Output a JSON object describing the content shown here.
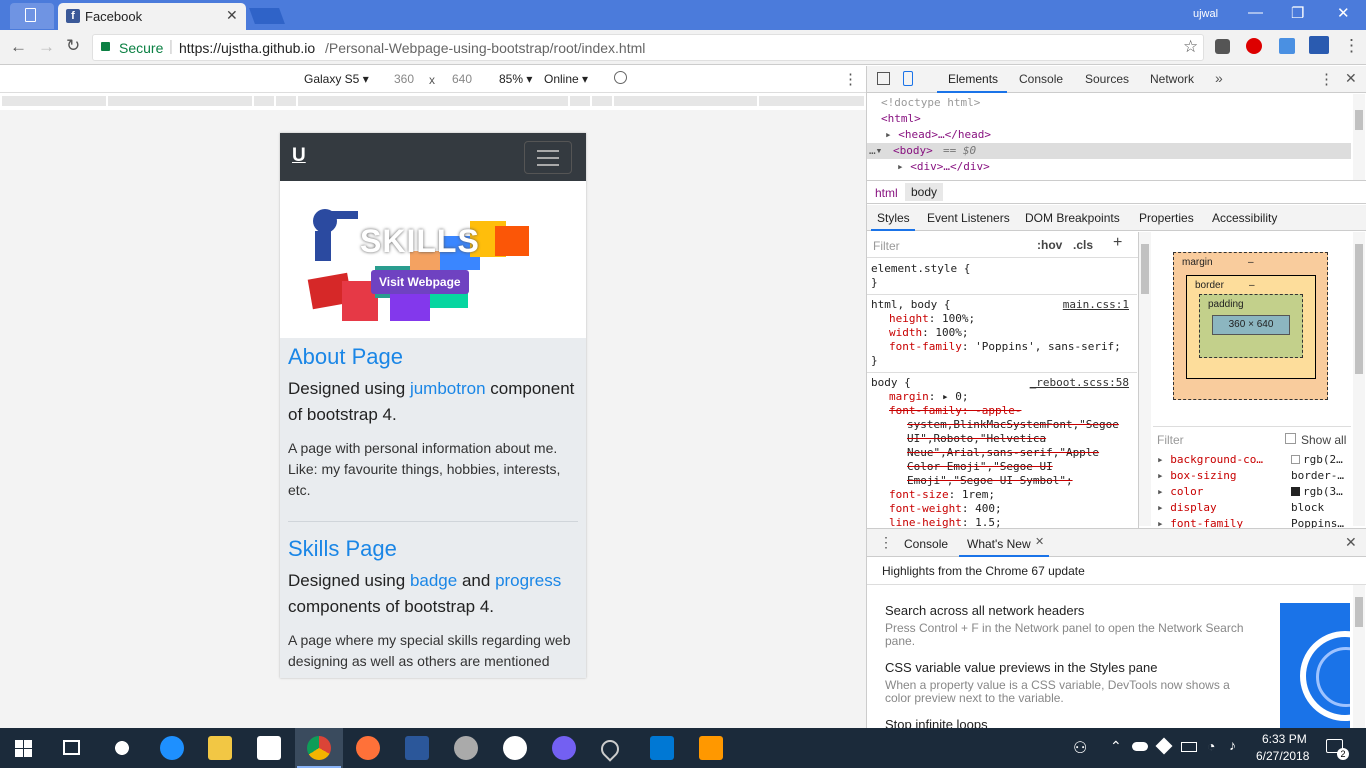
{
  "window": {
    "tab_title": "Facebook",
    "user": "ujwal"
  },
  "address": {
    "secure_label": "Secure",
    "url_host": "https://ujstha.github.io",
    "url_path": "/Personal-Webpage-using-bootstrap/root/index.html"
  },
  "device_toolbar": {
    "device": "Galaxy S5",
    "width": "360",
    "times": "x",
    "height": "640",
    "zoom": "85%",
    "network": "Online"
  },
  "page": {
    "brand": "U",
    "hero_text": "SKILLS",
    "hero_button": "Visit Webpage",
    "about": {
      "title": "About Page",
      "lead_prefix": "Designed using",
      "lead_link": "jumbotron",
      "lead_suffix": "component of bootstrap 4.",
      "para": "A page with personal information about me. Like: my favourite things, hobbies, interests, etc."
    },
    "skills": {
      "title": "Skills Page",
      "lead_prefix": "Designed using",
      "lead_link1": "badge",
      "lead_and": "and",
      "lead_link2": "progress",
      "lead_suffix": "components of bootstrap 4.",
      "para": "A page where my special skills regarding web designing as well as others are mentioned"
    }
  },
  "devtools": {
    "tabs": [
      "Elements",
      "Console",
      "Sources",
      "Network"
    ],
    "dom": {
      "doctype": "<!doctype html>",
      "html_open": "<html>",
      "head": "<head>…</head>",
      "body": "<body>",
      "body_eq": "== $0",
      "div": "<div>…</div>"
    },
    "breadcrumbs": [
      "html",
      "body"
    ],
    "subtabs": [
      "Styles",
      "Event Listeners",
      "DOM Breakpoints",
      "Properties",
      "Accessibility"
    ],
    "filter_placeholder": "Filter",
    "hov": ":hov",
    "cls": ".cls",
    "rules": {
      "element_style": "element.style {",
      "close": "}",
      "htmlbody_sel": "html, body {",
      "htmlbody_src": "main.css:1",
      "height_p": "height",
      "height_v": "100%;",
      "width_p": "width",
      "width_v": "100%;",
      "ff_p": "font-family",
      "ff_v": "'Poppins', sans-serif;",
      "body_sel": "body {",
      "body_src": "_reboot.scss:58",
      "margin_p": "margin",
      "margin_v": "0;",
      "ff2_line1": "font-family: -apple-",
      "ff2_line2": "system,BlinkMacSystemFont,\"Segoe",
      "ff2_line3": "UI\",Roboto,\"Helvetica",
      "ff2_line4": "Neue\",Arial,sans-serif,\"Apple",
      "ff2_line5": "Color Emoji\",\"Segoe UI",
      "ff2_line6": "Emoji\",\"Segoe UI Symbol\";",
      "fs_p": "font-size",
      "fs_v": "1rem;",
      "fw_p": "font-weight",
      "fw_v": "400;",
      "lh_p": "line-height",
      "lh_v": "1.5;"
    },
    "box": {
      "margin": "margin",
      "border": "border",
      "padding": "padding",
      "content": "360 × 640",
      "dash": "–"
    },
    "computed_filter": "Filter",
    "show_all": "Show all",
    "computed": [
      {
        "prop": "background-co…",
        "val": "rgb(2…"
      },
      {
        "prop": "box-sizing",
        "val": "border-…"
      },
      {
        "prop": "color",
        "val": "rgb(3…"
      },
      {
        "prop": "display",
        "val": "block"
      },
      {
        "prop": "font-family",
        "val": "Poppins…"
      }
    ],
    "drawer": {
      "tab1": "Console",
      "tab2": "What's New",
      "highlights": "Highlights from the Chrome 67 update",
      "items": [
        {
          "title": "Search across all network headers",
          "desc": "Press Control + F in the Network panel to open the Network Search pane."
        },
        {
          "title": "CSS variable value previews in the Styles pane",
          "desc": "When a property value is a CSS variable, DevTools now shows a color preview next to the variable."
        },
        {
          "title": "Stop infinite loops",
          "desc": ""
        }
      ]
    }
  },
  "taskbar": {
    "time": "6:33 PM",
    "date": "6/27/2018",
    "notif_count": "2"
  }
}
